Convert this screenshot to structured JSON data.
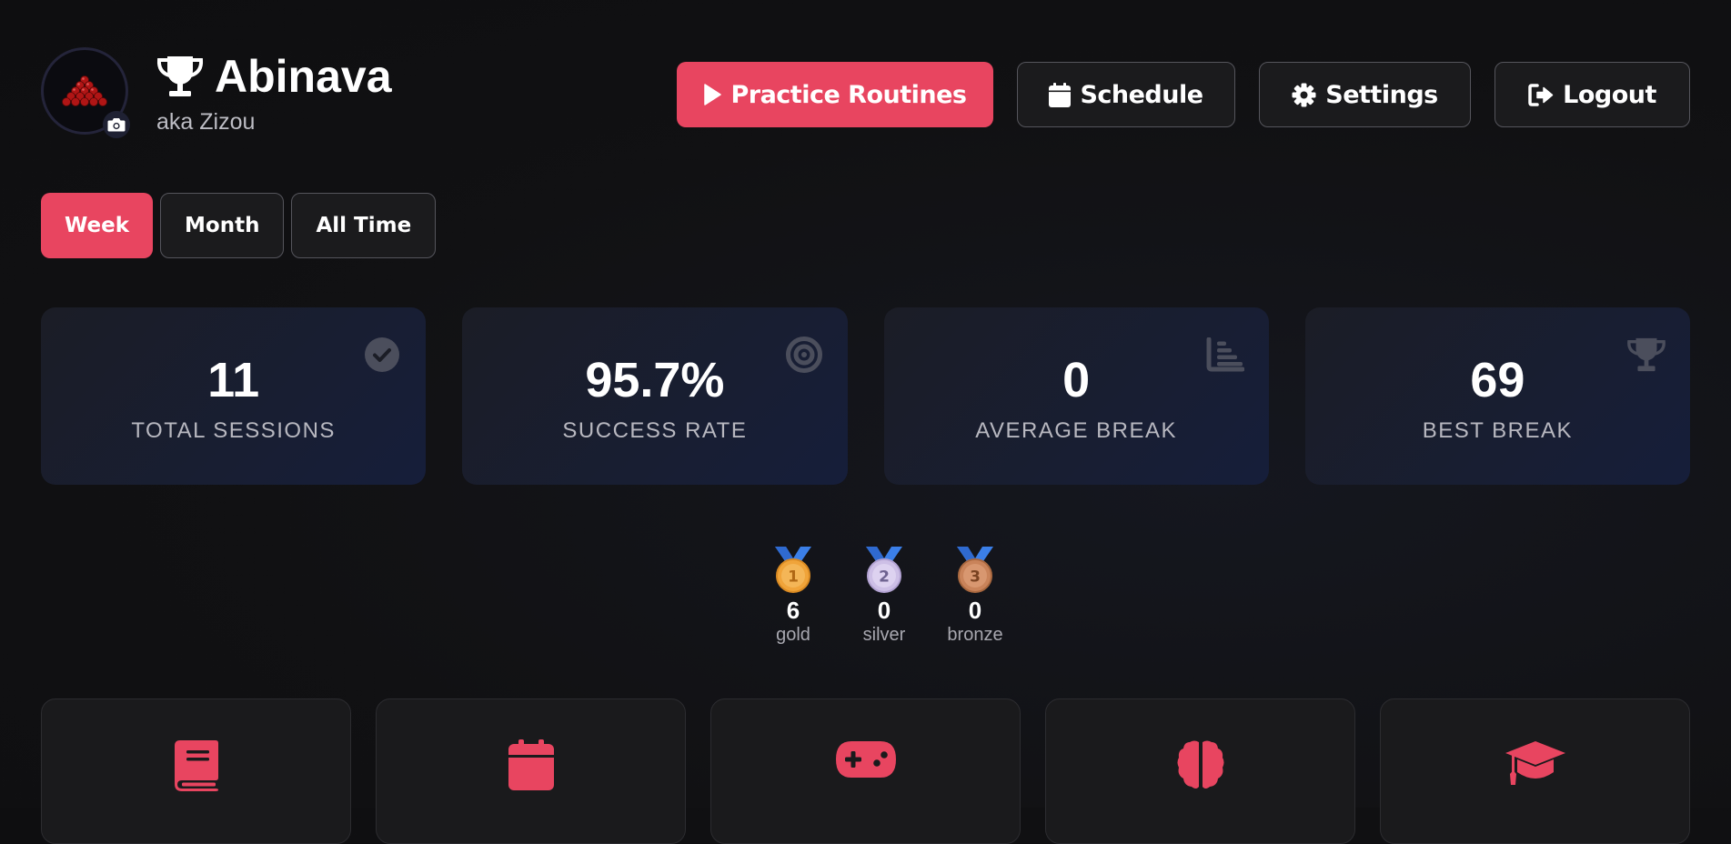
{
  "profile": {
    "name": "Abinava",
    "nickname": "aka Zizou"
  },
  "actions": {
    "practice": "Practice Routines",
    "schedule": "Schedule",
    "settings": "Settings",
    "logout": "Logout"
  },
  "range_tabs": {
    "week": "Week",
    "month": "Month",
    "all_time": "All Time",
    "selected": "Week"
  },
  "stats": [
    {
      "value": "11",
      "label": "TOTAL SESSIONS",
      "icon": "check-circle-icon"
    },
    {
      "value": "95.7%",
      "label": "SUCCESS RATE",
      "icon": "target-icon"
    },
    {
      "value": "0",
      "label": "AVERAGE BREAK",
      "icon": "bar-chart-icon"
    },
    {
      "value": "69",
      "label": "BEST BREAK",
      "icon": "trophy-icon"
    }
  ],
  "medals": [
    {
      "rank": "1",
      "count": "6",
      "name": "gold",
      "color": "#f0a43a"
    },
    {
      "rank": "2",
      "count": "0",
      "name": "silver",
      "color": "#d9cdf0"
    },
    {
      "rank": "3",
      "count": "0",
      "name": "bronze",
      "color": "#c9835a"
    }
  ],
  "tiles": [
    {
      "icon": "book-icon"
    },
    {
      "icon": "calendar-icon"
    },
    {
      "icon": "gamepad-icon"
    },
    {
      "icon": "brain-icon"
    },
    {
      "icon": "graduation-cap-icon"
    }
  ],
  "colors": {
    "accent": "#e84560",
    "background": "#111113",
    "card": "#1a1a1c"
  }
}
